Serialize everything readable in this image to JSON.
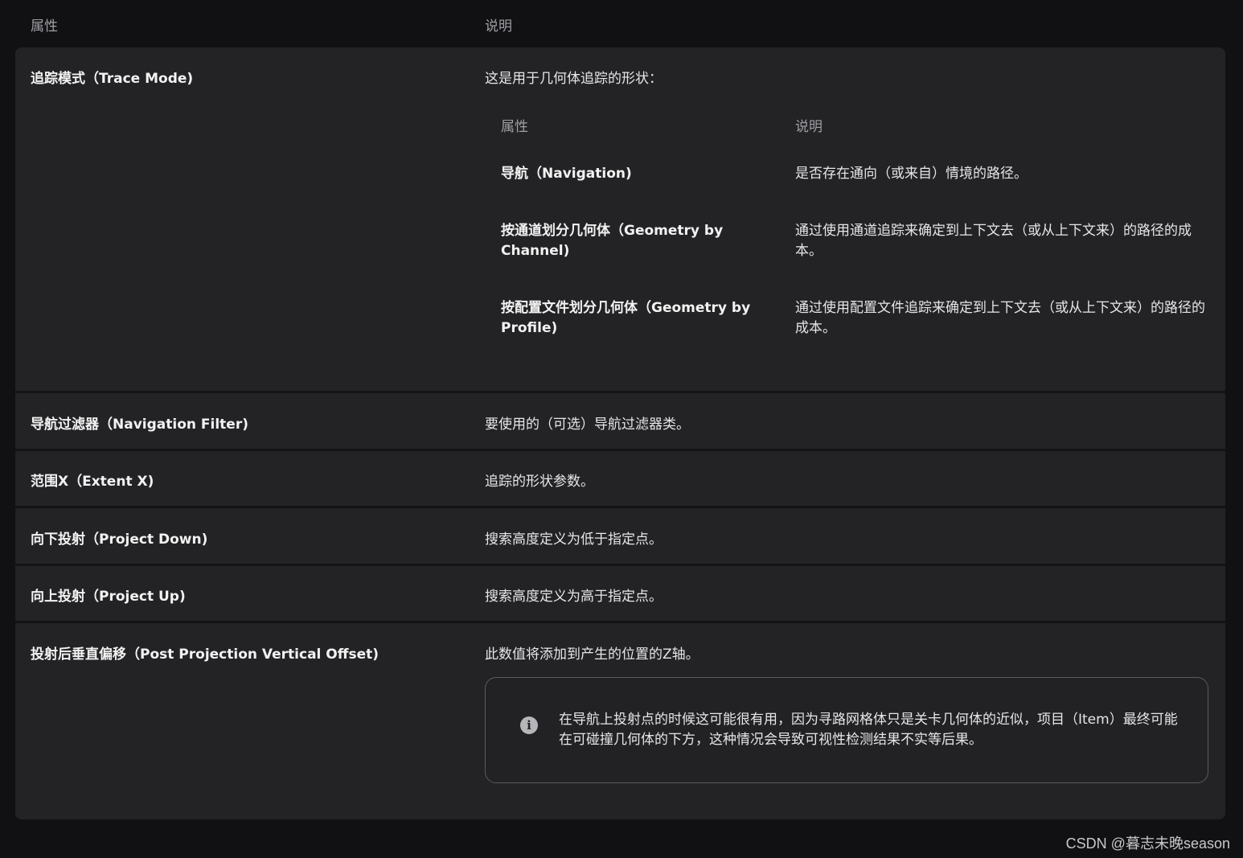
{
  "header": {
    "property_label": "属性",
    "description_label": "说明"
  },
  "rows": [
    {
      "name": "追踪模式（Trace Mode)",
      "description": "这是用于几何体追踪的形状："
    },
    {
      "name": "导航过滤器（Navigation Filter)",
      "description": "要使用的（可选）导航过滤器类。"
    },
    {
      "name": "范围X（Extent X)",
      "description": "追踪的形状参数。"
    },
    {
      "name": "向下投射（Project Down)",
      "description": "搜索高度定义为低于指定点。"
    },
    {
      "name": "向上投射（Project Up)",
      "description": "搜索高度定义为高于指定点。"
    },
    {
      "name": "投射后垂直偏移（Post Projection Vertical Offset)",
      "description": "此数值将添加到产生的位置的Z轴。"
    }
  ],
  "nested_table": {
    "property_label": "属性",
    "description_label": "说明",
    "rows": [
      {
        "name": "导航（Navigation)",
        "description": "是否存在通向（或来自）情境的路径。"
      },
      {
        "name": "按通道划分几何体（Geometry by Channel)",
        "description": "通过使用通道追踪来确定到上下文去（或从上下文来）的路径的成本。"
      },
      {
        "name": "按配置文件划分几何体（Geometry by Profile)",
        "description": "通过使用配置文件追踪来确定到上下文去（或从上下文来）的路径的成本。"
      }
    ]
  },
  "note": {
    "icon": "info-icon",
    "text": "在导航上投射点的时候这可能很有用，因为寻路网格体只是关卡几何体的近似，项目（Item）最终可能在可碰撞几何体的下方，这种情况会导致可视性检测结果不实等后果。"
  },
  "watermark": "CSDN @暮志未晚season"
}
